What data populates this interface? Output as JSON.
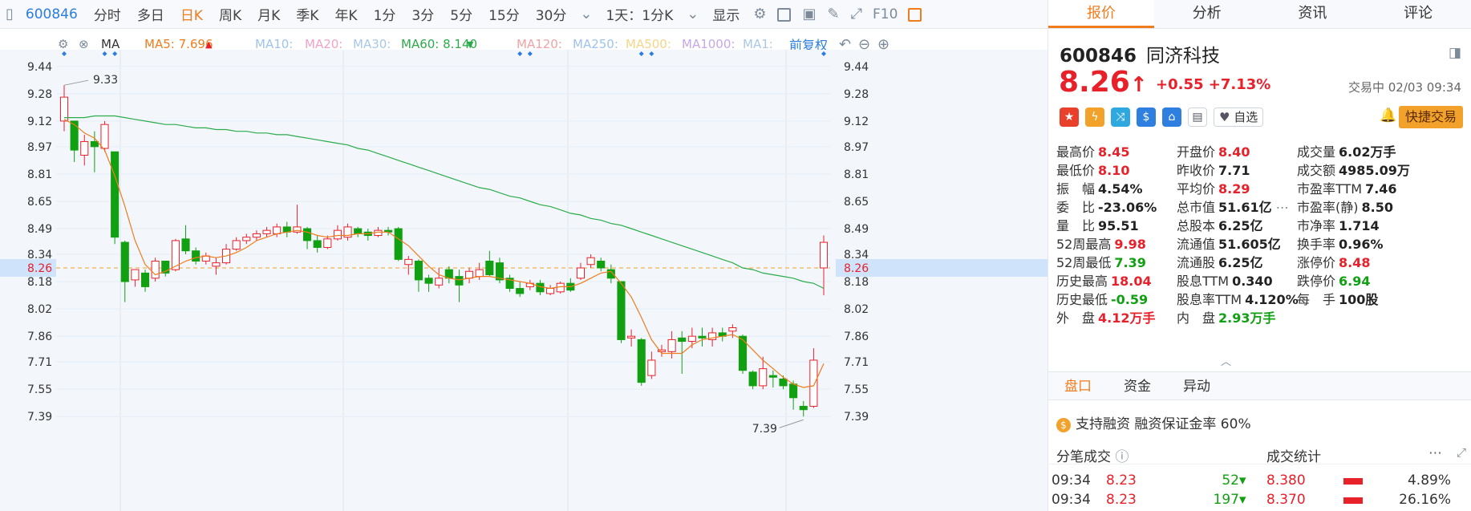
{
  "toolbar": {
    "code": "600846",
    "items": [
      "分时",
      "多日",
      "日K",
      "周K",
      "月K",
      "季K",
      "年K",
      "1分",
      "3分",
      "5分",
      "15分",
      "30分"
    ],
    "active": "日K",
    "chip_text": "1天：1分K",
    "display_label": "显示",
    "f10_label": "F10"
  },
  "ma_legend": {
    "ma_label": "MA",
    "ma5": "MA5: 7.696",
    "ma10": "MA10:",
    "ma20": "MA20:",
    "ma30": "MA30:",
    "ma60": "MA60: 8.140",
    "ma120": "MA120:",
    "ma250": "MA250:",
    "ma500": "MA500:",
    "ma1000": "MA1000:",
    "ma1": "MA1:",
    "adjust": "前复权"
  },
  "chart_data": {
    "type": "candlestick",
    "y_ticks": [
      "9.44",
      "9.28",
      "9.12",
      "8.97",
      "8.81",
      "8.65",
      "8.49",
      "8.34",
      "8.18",
      "8.02",
      "7.86",
      "7.71",
      "7.55",
      "7.39"
    ],
    "ylim": [
      7.33,
      9.5
    ],
    "current_price": "8.26",
    "high_label": "9.33",
    "low_label": "7.39",
    "candles": [
      [
        9.12,
        9.26,
        9.33,
        9.06
      ],
      [
        9.12,
        8.95,
        9.12,
        8.88
      ],
      [
        8.92,
        9.0,
        9.04,
        8.86
      ],
      [
        9.0,
        8.97,
        9.06,
        8.82
      ],
      [
        8.96,
        9.1,
        9.12,
        8.94
      ],
      [
        8.94,
        8.44,
        8.94,
        8.4
      ],
      [
        8.41,
        8.18,
        8.42,
        8.06
      ],
      [
        8.19,
        8.25,
        8.25,
        8.15
      ],
      [
        8.23,
        8.15,
        8.25,
        8.12
      ],
      [
        8.2,
        8.3,
        8.32,
        8.18
      ],
      [
        8.3,
        8.23,
        8.3,
        8.21
      ],
      [
        8.25,
        8.42,
        8.43,
        8.24
      ],
      [
        8.43,
        8.36,
        8.51,
        8.34
      ],
      [
        8.36,
        8.3,
        8.38,
        8.28
      ],
      [
        8.3,
        8.33,
        8.35,
        8.28
      ],
      [
        8.27,
        8.29,
        8.32,
        8.22
      ],
      [
        8.29,
        8.37,
        8.4,
        8.28
      ],
      [
        8.37,
        8.42,
        8.44,
        8.36
      ],
      [
        8.42,
        8.44,
        8.46,
        8.4
      ],
      [
        8.44,
        8.46,
        8.48,
        8.42
      ],
      [
        8.46,
        8.48,
        8.5,
        8.44
      ],
      [
        8.46,
        8.5,
        8.52,
        8.44
      ],
      [
        8.5,
        8.47,
        8.53,
        8.44
      ],
      [
        8.47,
        8.5,
        8.63,
        8.46
      ],
      [
        8.49,
        8.42,
        8.5,
        8.37
      ],
      [
        8.42,
        8.38,
        8.45,
        8.35
      ],
      [
        8.38,
        8.43,
        8.45,
        8.37
      ],
      [
        8.43,
        8.48,
        8.51,
        8.42
      ],
      [
        8.44,
        8.5,
        8.52,
        8.42
      ],
      [
        8.49,
        8.46,
        8.5,
        8.44
      ],
      [
        8.47,
        8.45,
        8.49,
        8.42
      ],
      [
        8.45,
        8.48,
        8.5,
        8.44
      ],
      [
        8.48,
        8.47,
        8.5,
        8.45
      ],
      [
        8.49,
        8.31,
        8.5,
        8.3
      ],
      [
        8.28,
        8.31,
        8.33,
        8.22
      ],
      [
        8.3,
        8.19,
        8.31,
        8.12
      ],
      [
        8.2,
        8.17,
        8.22,
        8.12
      ],
      [
        8.16,
        8.2,
        8.26,
        8.14
      ],
      [
        8.25,
        8.2,
        8.27,
        8.17
      ],
      [
        8.21,
        8.16,
        8.25,
        8.06
      ],
      [
        8.2,
        8.24,
        8.26,
        8.17
      ],
      [
        8.21,
        8.25,
        8.29,
        8.19
      ],
      [
        8.3,
        8.22,
        8.36,
        8.21
      ],
      [
        8.29,
        8.19,
        8.32,
        8.17
      ],
      [
        8.2,
        8.14,
        8.22,
        8.12
      ],
      [
        8.14,
        8.11,
        8.18,
        8.09
      ],
      [
        8.15,
        8.17,
        8.19,
        8.13
      ],
      [
        8.17,
        8.12,
        8.19,
        8.1
      ],
      [
        8.11,
        8.14,
        8.16,
        8.1
      ],
      [
        8.12,
        8.17,
        8.18,
        8.11
      ],
      [
        8.17,
        8.13,
        8.2,
        8.12
      ],
      [
        8.2,
        8.26,
        8.29,
        8.19
      ],
      [
        8.28,
        8.32,
        8.34,
        8.26
      ],
      [
        8.3,
        8.26,
        8.32,
        8.24
      ],
      [
        8.25,
        8.2,
        8.28,
        8.17
      ],
      [
        8.18,
        7.84,
        8.18,
        7.82
      ],
      [
        7.85,
        7.86,
        7.9,
        7.8
      ],
      [
        7.84,
        7.59,
        7.85,
        7.57
      ],
      [
        7.63,
        7.72,
        7.77,
        7.61
      ],
      [
        7.77,
        7.78,
        7.81,
        7.74
      ],
      [
        7.77,
        7.84,
        7.89,
        7.73
      ],
      [
        7.85,
        7.83,
        7.89,
        7.64
      ],
      [
        7.83,
        7.86,
        7.91,
        7.79
      ],
      [
        7.86,
        7.85,
        7.91,
        7.8
      ],
      [
        7.84,
        7.88,
        7.91,
        7.8
      ],
      [
        7.88,
        7.86,
        7.91,
        7.83
      ],
      [
        7.89,
        7.91,
        7.93,
        7.85
      ],
      [
        7.86,
        7.66,
        7.87,
        7.64
      ],
      [
        7.65,
        7.57,
        7.66,
        7.55
      ],
      [
        7.57,
        7.67,
        7.74,
        7.55
      ],
      [
        7.63,
        7.62,
        7.66,
        7.56
      ],
      [
        7.61,
        7.57,
        7.63,
        7.55
      ],
      [
        7.58,
        7.5,
        7.6,
        7.43
      ],
      [
        7.45,
        7.43,
        7.48,
        7.39
      ],
      [
        7.45,
        7.72,
        7.79,
        7.44
      ],
      [
        8.26,
        8.41,
        8.45,
        8.1
      ]
    ],
    "ma5": [
      9.13,
      9.1,
      9.05,
      9.02,
      8.95,
      8.8,
      8.62,
      8.42,
      8.28,
      8.22,
      8.24,
      8.27,
      8.3,
      8.32,
      8.33,
      8.32,
      8.33,
      8.35,
      8.38,
      8.42,
      8.44,
      8.46,
      8.47,
      8.48,
      8.47,
      8.45,
      8.44,
      8.45,
      8.45,
      8.46,
      8.46,
      8.47,
      8.47,
      8.43,
      8.39,
      8.33,
      8.27,
      8.22,
      8.2,
      8.19,
      8.2,
      8.21,
      8.21,
      8.2,
      8.19,
      8.18,
      8.17,
      8.15,
      8.14,
      8.15,
      8.15,
      8.17,
      8.2,
      8.23,
      8.24,
      8.17,
      8.09,
      7.97,
      7.84,
      7.76,
      7.76,
      7.76,
      7.81,
      7.84,
      7.85,
      7.86,
      7.87,
      7.84,
      7.78,
      7.72,
      7.67,
      7.62,
      7.58,
      7.56,
      7.57,
      7.7
    ],
    "ma60": [
      9.14,
      9.14,
      9.14,
      9.15,
      9.15,
      9.15,
      9.14,
      9.13,
      9.12,
      9.11,
      9.1,
      9.1,
      9.09,
      9.08,
      9.08,
      9.07,
      9.07,
      9.06,
      9.06,
      9.05,
      9.05,
      9.04,
      9.04,
      9.03,
      9.02,
      9.01,
      9.0,
      8.99,
      8.98,
      8.96,
      8.95,
      8.93,
      8.91,
      8.89,
      8.87,
      8.85,
      8.83,
      8.81,
      8.79,
      8.77,
      8.75,
      8.73,
      8.72,
      8.7,
      8.68,
      8.67,
      8.65,
      8.63,
      8.62,
      8.6,
      8.58,
      8.57,
      8.55,
      8.54,
      8.52,
      8.51,
      8.49,
      8.47,
      8.45,
      8.43,
      8.41,
      8.39,
      8.37,
      8.35,
      8.33,
      8.31,
      8.29,
      8.26,
      8.25,
      8.23,
      8.22,
      8.21,
      8.2,
      8.18,
      8.17,
      8.14
    ]
  },
  "panel": {
    "tabs": [
      "报价",
      "分析",
      "资讯",
      "评论"
    ],
    "active_tab": "报价",
    "code": "600846",
    "name": "同济科技",
    "price": "8.26",
    "arrow": "↑",
    "change": "+0.55",
    "change_pct": "+7.13%",
    "status": "交易中 02/03 09:34",
    "fav_label": "自选",
    "quick_label": "快捷交易",
    "stats": [
      [
        [
          "最高价",
          "8.45",
          "red"
        ],
        [
          "开盘价",
          "8.40",
          "red"
        ],
        [
          "成交量",
          "6.02万手",
          "blk"
        ]
      ],
      [
        [
          "最低价",
          "8.10",
          "red"
        ],
        [
          "昨收价",
          "7.71",
          "blk"
        ],
        [
          "成交额",
          "4985.09万",
          "blk"
        ]
      ],
      [
        [
          "振　幅",
          "4.54%",
          "blk"
        ],
        [
          "平均价",
          "8.29",
          "red"
        ],
        [
          "市盈率TTM",
          "7.46",
          "blk"
        ]
      ],
      [
        [
          "委　比",
          "-23.06%",
          "blk"
        ],
        [
          "总市值",
          "51.61亿",
          "blk"
        ],
        [
          "市盈率(静)",
          "8.50",
          "blk"
        ]
      ],
      [
        [
          "量　比",
          "95.51",
          "blk"
        ],
        [
          "总股本",
          "6.25亿",
          "blk"
        ],
        [
          "市净率",
          "1.714",
          "blk"
        ]
      ],
      [
        [
          "52周最高",
          "9.98",
          "red"
        ],
        [
          "流通值",
          "51.605亿",
          "blk"
        ],
        [
          "换手率",
          "0.96%",
          "blk"
        ]
      ],
      [
        [
          "52周最低",
          "7.39",
          "green"
        ],
        [
          "流通股",
          "6.25亿",
          "blk"
        ],
        [
          "涨停价",
          "8.48",
          "red"
        ]
      ],
      [
        [
          "历史最高",
          "18.04",
          "red"
        ],
        [
          "股息TTM",
          "0.340",
          "blk"
        ],
        [
          "跌停价",
          "6.94",
          "green"
        ]
      ],
      [
        [
          "历史最低",
          "-0.59",
          "green"
        ],
        [
          "股息率TTM",
          "4.120%",
          "blk"
        ],
        [
          "每　手",
          "100股",
          "blk"
        ]
      ],
      [
        [
          "外　盘",
          "4.12万手",
          "red"
        ],
        [
          "内　盘",
          "2.93万手",
          "green"
        ],
        [
          "",
          "",
          " "
        ]
      ]
    ],
    "sub_tabs": [
      "盘口",
      "资金",
      "异动"
    ],
    "active_sub": "盘口",
    "margin_text": "支持融资 融资保证金率 60%",
    "tick_header": "分笔成交",
    "deal_header": "成交统计",
    "ticks": [
      [
        "09:34",
        "8.23",
        "52"
      ],
      [
        "09:34",
        "8.23",
        "197"
      ]
    ],
    "deals": [
      [
        "8.380",
        "4.89%"
      ],
      [
        "8.370",
        "26.16%"
      ]
    ]
  }
}
